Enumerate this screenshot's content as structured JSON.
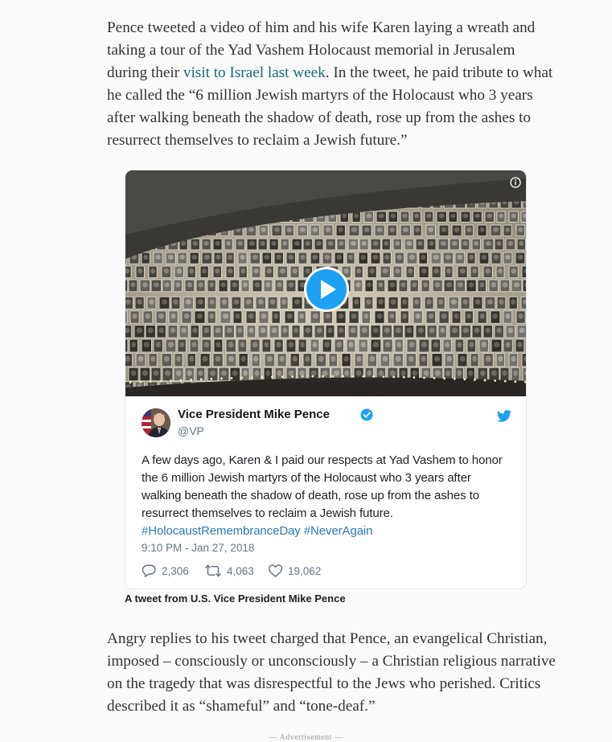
{
  "article": {
    "para1_part1": "Pence tweeted a video of him and his wife Karen laying a wreath and taking a tour of the Yad Vashem Holocaust memorial in Jerusalem during their ",
    "para1_link": "visit to Israel last week",
    "para1_part2": ". In the tweet, he paid tribute to what he called the “6 million Jewish martyrs of the Holocaust who 3 years after walking beneath the shadow of death, rose up from the ashes to resurrect themselves to reclaim a Jewish future.”",
    "para2": "Angry replies to his tweet charged that Pence, an evangelical Christian, imposed – consciously or unconsciously – a Christian religious narrative on the tragedy that was disrespectful to the Jews who perished. Critics described it as “shameful” and “tone-deaf.”",
    "caption": "A tweet from U.S. Vice President Mike Pence",
    "ad_label": "— Advertisement —"
  },
  "tweet": {
    "author_name": "Vice President Mike Pence",
    "handle": "@VP",
    "text": "A few days ago, Karen & I paid our respects at Yad Vashem to honor the 6 million Jewish martyrs of the Holocaust who 3 years after walking beneath the shadow of death, rose up from the ashes to resurrect themselves to reclaim a Jewish future.",
    "hashtag1": "#HolocaustRemembranceDay",
    "hashtag2": "#NeverAgain",
    "timestamp": "9:10 PM - Jan 27, 2018",
    "replies": "2,306",
    "retweets": "4,063",
    "likes": "19,062",
    "colors": {
      "link": "#1a6a7c",
      "hashtag": "#2b7bb9",
      "twitter_blue": "#1da1f2",
      "muted": "#657786"
    }
  },
  "icons": {
    "info": "info-icon",
    "play": "play-icon",
    "verified": "verified-badge-icon",
    "twitter": "twitter-bird-icon",
    "reply": "reply-icon",
    "retweet": "retweet-icon",
    "like": "heart-icon"
  }
}
